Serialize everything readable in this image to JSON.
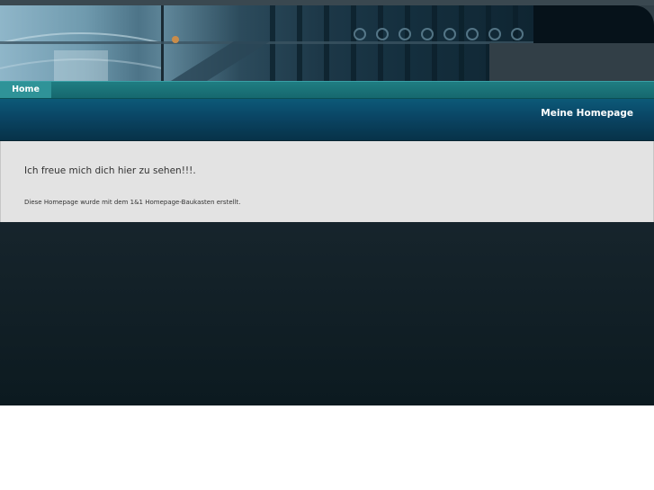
{
  "nav": {
    "items": [
      {
        "label": "Home",
        "active": true
      }
    ]
  },
  "header": {
    "site_title": "Meine Homepage"
  },
  "content": {
    "welcome_text": "Ich freue mich dich hier zu sehen!!!.",
    "builder_note": "Diese Homepage wurde mit dem 1&1 Homepage-Baukasten erstellt."
  },
  "colors": {
    "nav_bg": "#1a7277",
    "nav_active": "#2f9398",
    "title_bar": "#0a4564",
    "content_bg": "#e3e3e3",
    "page_bg": "#1b2a32"
  }
}
